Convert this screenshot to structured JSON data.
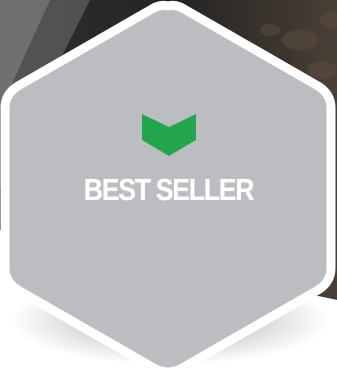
{
  "badge": {
    "label": "BEST SELLER",
    "icon": "chevron-down-icon",
    "colors": {
      "icon": "#23a64b",
      "fill": "#bcbdc1",
      "border": "#ffffff",
      "backdrop_dark": "#2b2a29",
      "backdrop_stone": "#4a3f35"
    }
  }
}
